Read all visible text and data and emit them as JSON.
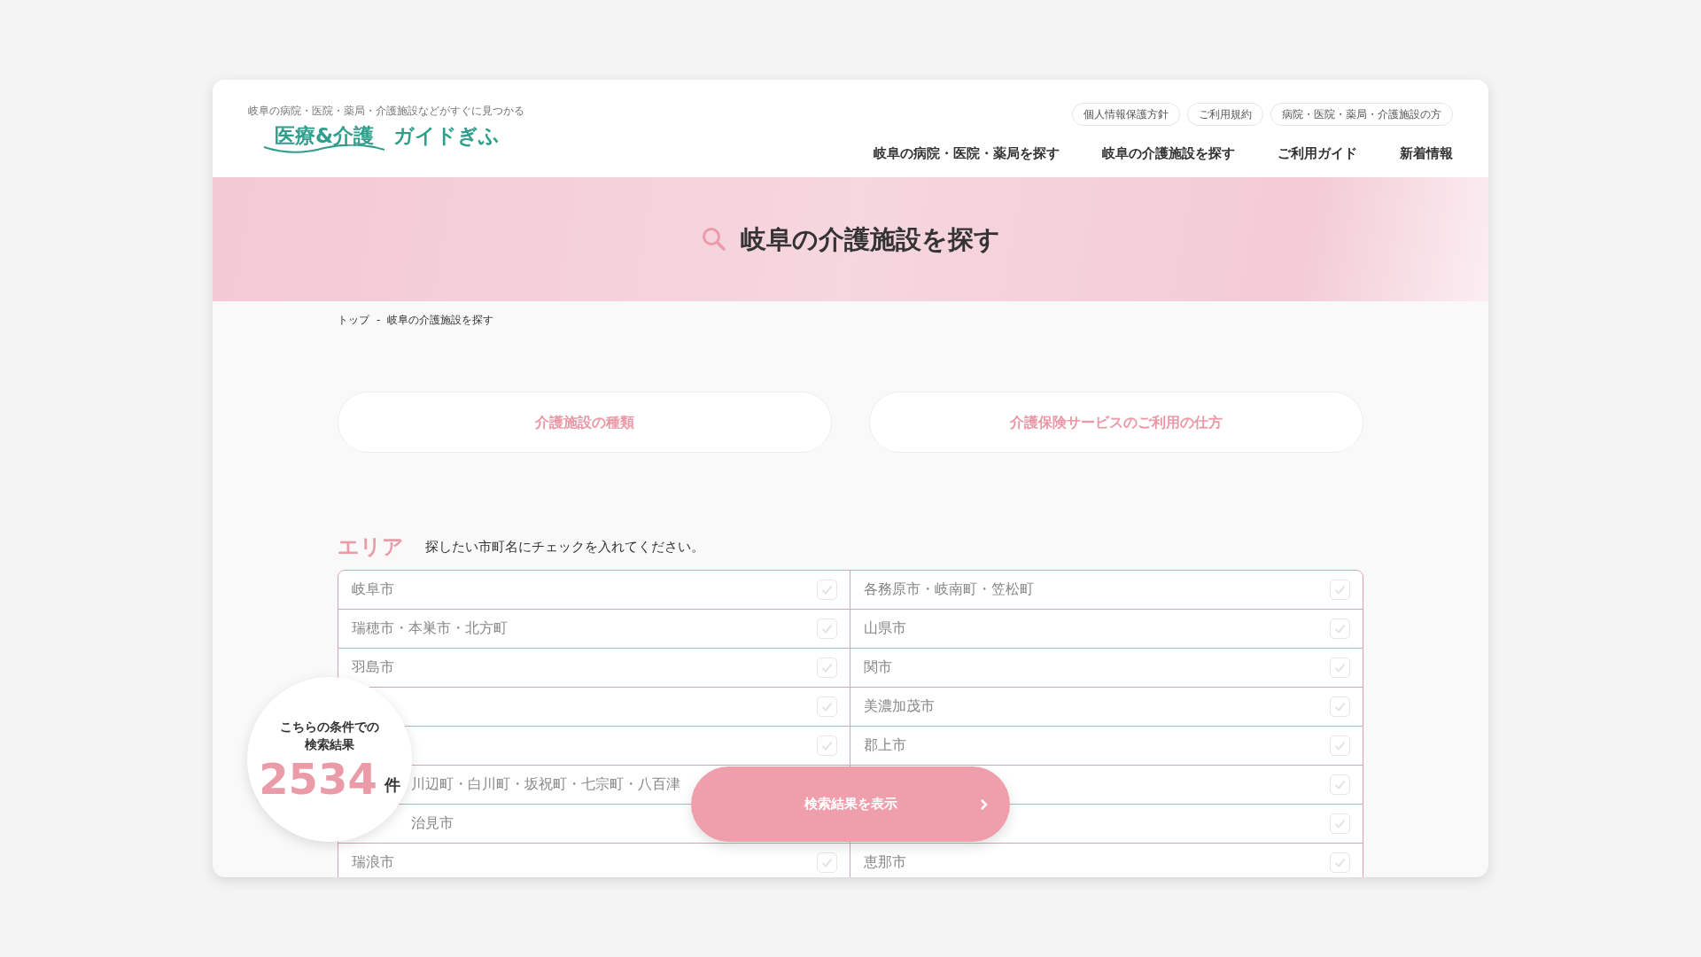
{
  "header": {
    "tagline": "岐阜の病院・医院・薬局・介護施設などがすぐに見つかる",
    "logo_main": "医療&介護",
    "logo_sub": "ガイドぎふ",
    "utility_links": [
      "個人情報保護方針",
      "ご利用規約",
      "病院・医院・薬局・介護施設の方"
    ],
    "nav": [
      "岐阜の病院・医院・薬局を探す",
      "岐阜の介護施設を探す",
      "ご利用ガイド",
      "新着情報"
    ]
  },
  "hero": {
    "title": "岐阜の介護施設を探す"
  },
  "breadcrumb": [
    {
      "label": "トップ"
    },
    {
      "label": "-"
    },
    {
      "label": "岐阜の介護施設を探す"
    }
  ],
  "guide_buttons": [
    "介護施設の種類",
    "介護保険サービスのご利用の仕方"
  ],
  "area": {
    "heading": "エリア",
    "hint": "探したい市町名にチェックを入れてください。",
    "cells": [
      {
        "text": "岐阜市",
        "checked": false
      },
      {
        "text": "各務原市・岐南町・笠松町",
        "checked": false
      },
      {
        "text": "瑞穂市・本巣市・北方町",
        "checked": false
      },
      {
        "text": "山県市",
        "checked": false
      },
      {
        "text": "羽島市",
        "checked": false
      },
      {
        "text": "関市",
        "checked": false
      },
      {
        "checked": false
      },
      {
        "text": "美濃加茂市",
        "checked": false
      },
      {
        "checked": false
      },
      {
        "text": "郡上市",
        "checked": false
      },
      {
        "text": "川辺町・白川町・坂祝町・七宗町・八百津"
      },
      {
        "checked": false
      },
      {
        "text": "治見市"
      },
      {
        "checked": false
      },
      {
        "text": "瑞浪市",
        "checked": false
      },
      {
        "text": "恵那市",
        "checked": false
      }
    ]
  },
  "result": {
    "caption": "こちらの条件での検索結果",
    "count": "2534",
    "unit": "件"
  },
  "show_button": {
    "label": "検索結果を表示"
  }
}
